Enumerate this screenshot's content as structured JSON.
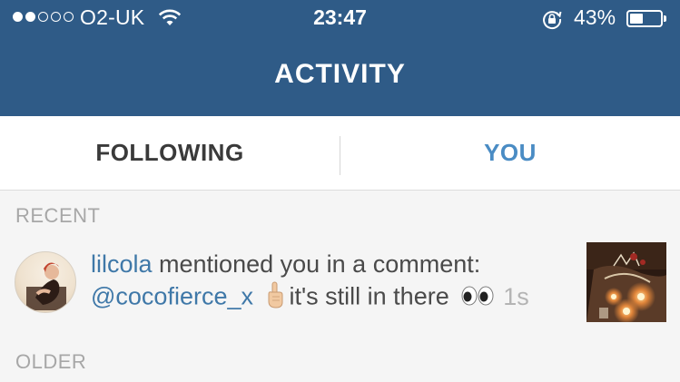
{
  "status_bar": {
    "carrier": "O2-UK",
    "time": "23:47",
    "battery_percent": "43%",
    "battery_level": 0.43,
    "signal_bars_filled": 2,
    "signal_bars_total": 5,
    "icons": [
      "wifi-icon",
      "rotation-lock-icon",
      "battery-icon"
    ]
  },
  "header": {
    "title": "ACTIVITY"
  },
  "tabs": {
    "following": "FOLLOWING",
    "you": "YOU",
    "active": "you"
  },
  "sections": {
    "recent": "RECENT",
    "older": "OLDER"
  },
  "notification": {
    "username": "lilcola",
    "action": " mentioned you in a comment:",
    "mention": "@cocofierce_x",
    "comment_text": "it's still in there",
    "emojis": [
      "pointing-up-emoji",
      "eyes-emoji"
    ],
    "timestamp": "1s"
  },
  "colors": {
    "header_bg": "#2f5b87",
    "link_blue": "#3f78a8",
    "active_tab": "#4a8cc4",
    "section_gray": "#a7a7a7"
  }
}
